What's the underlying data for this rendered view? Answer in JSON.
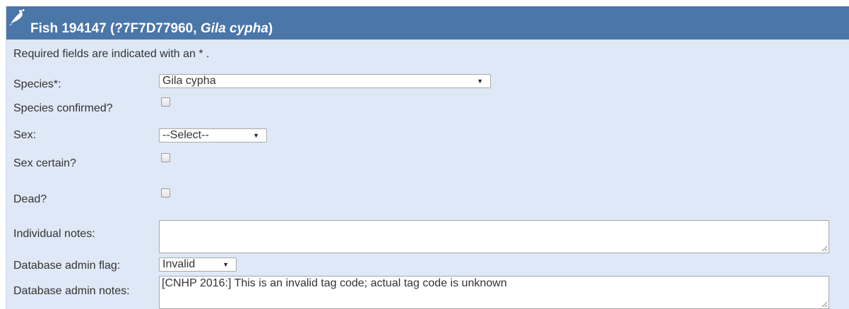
{
  "header": {
    "icon": "fish-icon",
    "title_prefix": "Fish 194147 (?7F7D77960, ",
    "title_species": "Gila cypha",
    "title_suffix": ")",
    "bg_color": "#4a76a8"
  },
  "form": {
    "required_note": "Required fields are indicated with an * .",
    "species": {
      "label": "Species*:",
      "value": "Gila cypha"
    },
    "species_confirmed": {
      "label": "Species confirmed?",
      "checked": false
    },
    "sex": {
      "label": "Sex:",
      "value": "--Select--"
    },
    "sex_certain": {
      "label": "Sex certain?",
      "checked": false
    },
    "dead": {
      "label": "Dead?",
      "checked": false
    },
    "individual_notes": {
      "label": "Individual notes:",
      "value": ""
    },
    "admin_flag": {
      "label": "Database admin flag:",
      "value": "Invalid"
    },
    "admin_notes": {
      "label": "Database admin notes:",
      "value": "[CNHP 2016:] This is an invalid tag code; actual tag code is unknown"
    }
  },
  "colors": {
    "panel_bg": "#dfe8f6",
    "header_bg": "#4a76a8"
  }
}
